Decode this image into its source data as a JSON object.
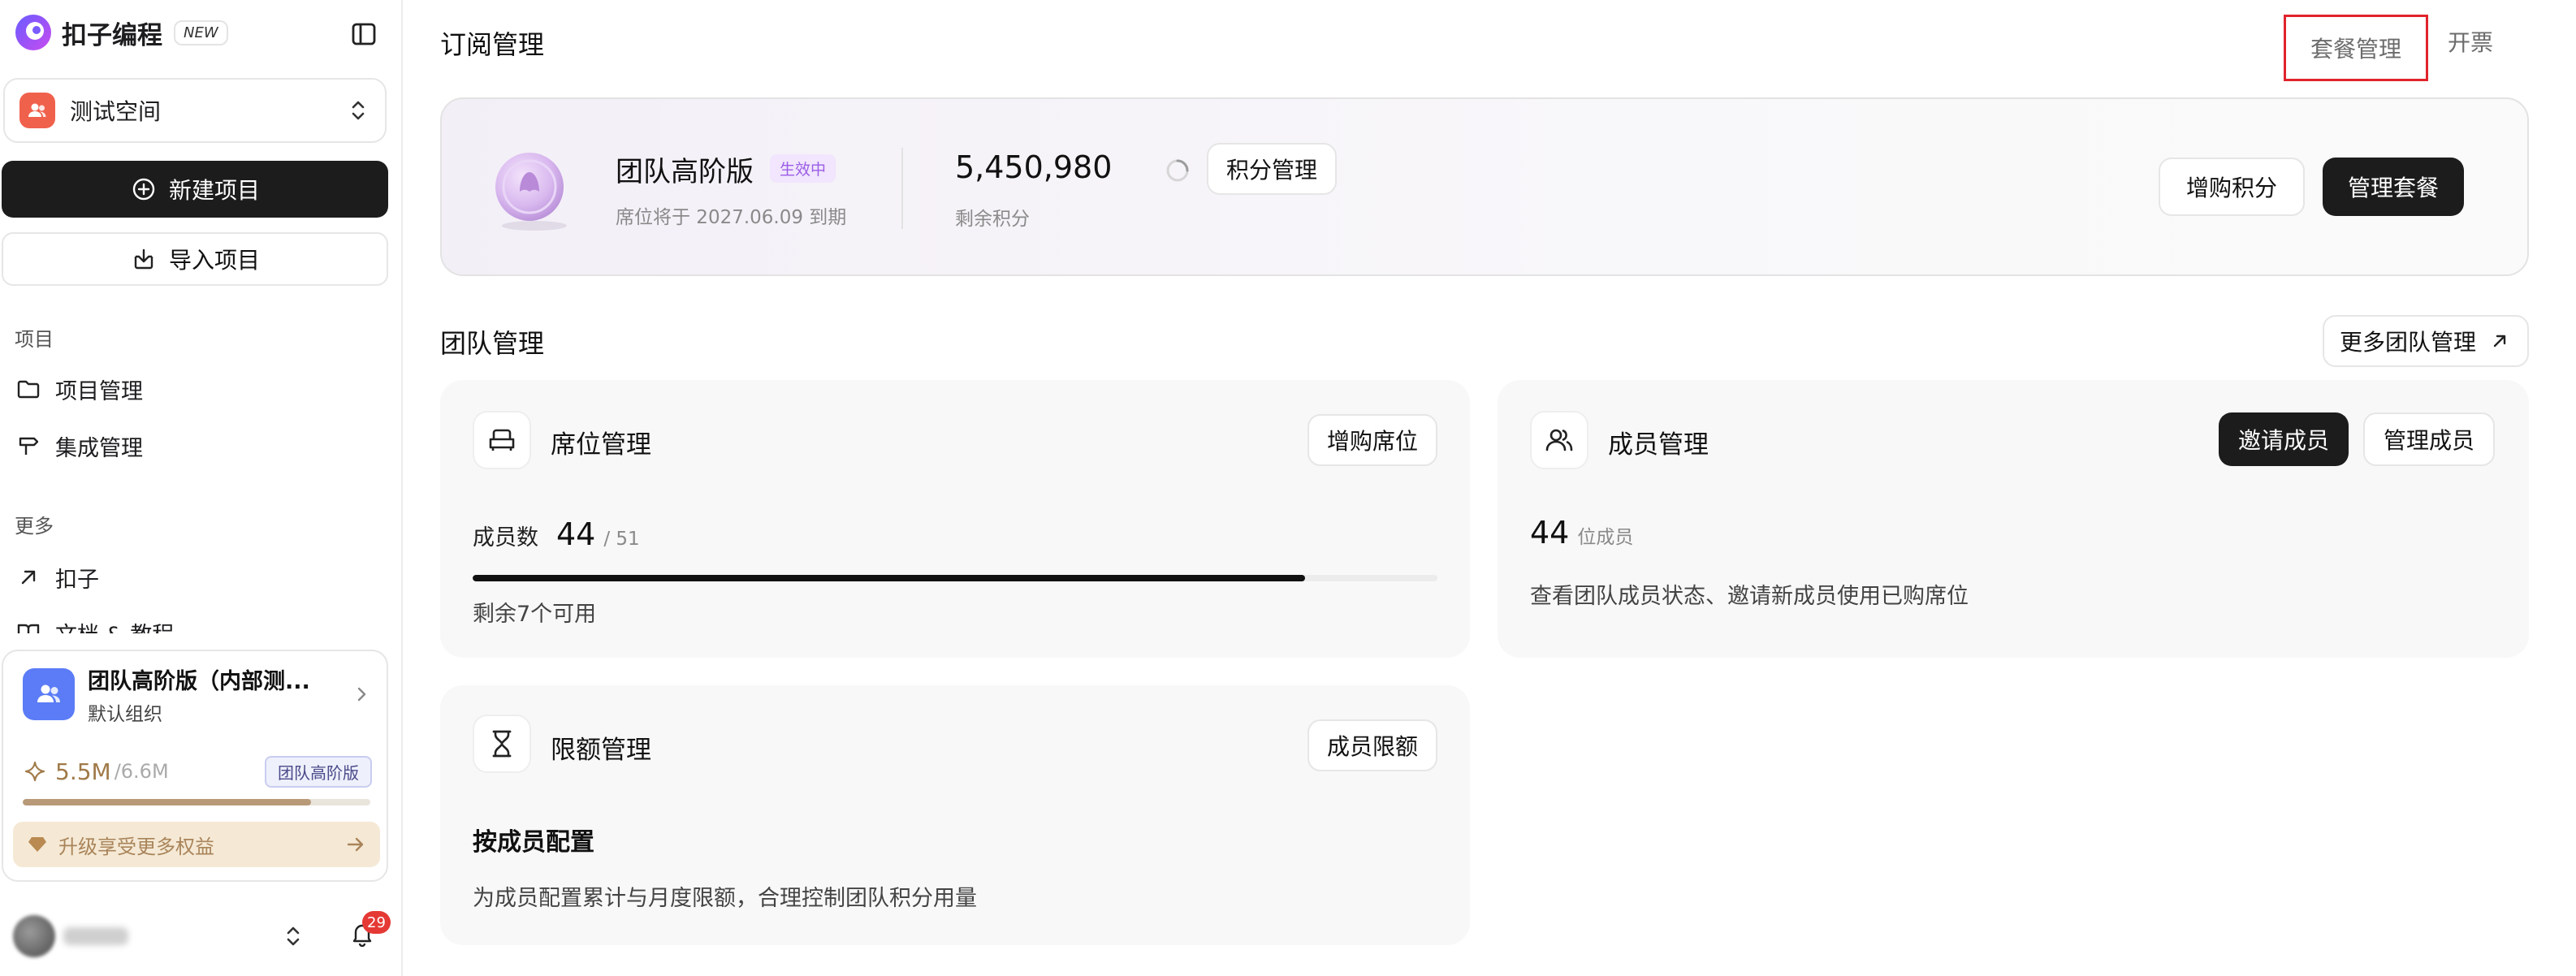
{
  "sidebar": {
    "brand": {
      "name": "扣子编程",
      "badge": "NEW"
    },
    "workspace": {
      "name": "测试空间"
    },
    "new_project": "新建项目",
    "import_project": "导入项目",
    "section_projects": "项目",
    "items_projects": [
      {
        "label": "项目管理",
        "icon": "folder-icon"
      },
      {
        "label": "集成管理",
        "icon": "signpost-icon"
      }
    ],
    "section_more": "更多",
    "items_more": [
      {
        "label": "扣子",
        "icon": "arrow-up-right-icon"
      },
      {
        "label": "文档 & 教程",
        "icon": "book-icon"
      }
    ],
    "plan_card": {
      "title": "团队高阶版（内部测...",
      "org": "默认组织",
      "credits": "5.5M",
      "credits_total": "/6.6M",
      "tier_badge": "团队高阶版",
      "usage_fraction": 0.83,
      "upgrade": "升级享受更多权益"
    },
    "notifications_count": "29"
  },
  "header": {
    "title": "订阅管理",
    "tabs": [
      {
        "label": "套餐管理",
        "active": true
      },
      {
        "label": "开票",
        "active": false
      }
    ]
  },
  "plan": {
    "name": "团队高阶版",
    "status": "生效中",
    "expiry": "席位将于 2027.06.09 到期",
    "credits": "5,450,980",
    "credits_label": "剩余积分",
    "credits_manage": "积分管理",
    "buy_credits": "增购积分",
    "manage_plan": "管理套餐"
  },
  "team": {
    "title": "团队管理",
    "more_button": "更多团队管理",
    "seats": {
      "title": "席位管理",
      "button": "增购席位",
      "members_label": "成员数",
      "used": "44",
      "total": "/ 51",
      "usage_fraction": 0.8627,
      "remaining": "剩余7个可用"
    },
    "members": {
      "title": "成员管理",
      "invite": "邀请成员",
      "manage": "管理成员",
      "count": "44",
      "count_unit": "位成员",
      "desc": "查看团队成员状态、邀请新成员使用已购席位"
    },
    "quota": {
      "title": "限额管理",
      "button": "成员限额",
      "subtitle": "按成员配置",
      "desc": "为成员配置累计与月度限额，合理控制团队积分用量"
    }
  },
  "colors": {
    "accent_dark": "#1c1c1c",
    "status_badge_bg": "#f1e6fd",
    "status_badge_text": "#9b5de5",
    "tab_highlight_border": "#e0242c",
    "notification_badge": "#e53935",
    "credits_color": "#a07a48"
  }
}
